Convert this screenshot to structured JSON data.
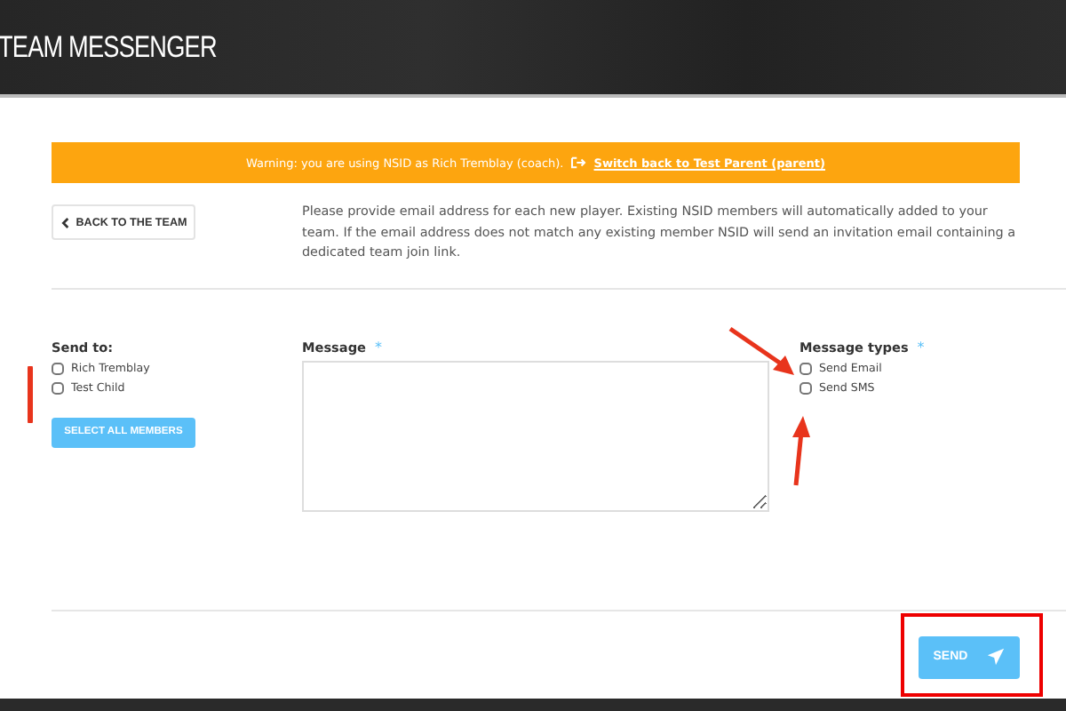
{
  "header": {
    "title": "TEAM MESSENGER"
  },
  "warning": {
    "text": "Warning: you are using NSID as Rich Tremblay (coach).",
    "link": "Switch back to Test Parent (parent)"
  },
  "back_button": {
    "label": "BACK TO THE TEAM"
  },
  "instructions": "Please provide email address for each new player. Existing NSID members will automatically added to your team. If the email address does not match any existing member NSID will send an invitation email containing a dedicated team join link.",
  "send_to": {
    "label": "Send to:",
    "members": [
      {
        "name": "Rich Tremblay",
        "checked": false
      },
      {
        "name": "Test Child",
        "checked": false
      }
    ],
    "select_all": "SELECT ALL MEMBERS"
  },
  "message": {
    "label": "Message",
    "required_mark": "*"
  },
  "message_types": {
    "label": "Message types",
    "required_mark": "*",
    "options": [
      {
        "name": "Send Email",
        "checked": false
      },
      {
        "name": "Send SMS",
        "checked": false
      }
    ]
  },
  "send_button": {
    "label": "SEND"
  }
}
